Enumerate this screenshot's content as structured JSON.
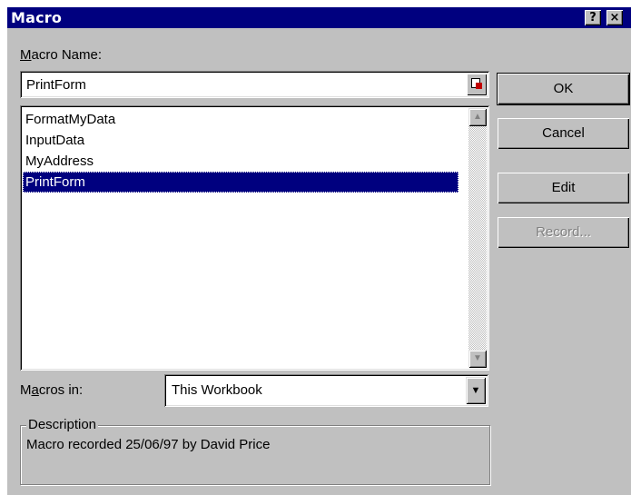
{
  "window": {
    "title": "Macro",
    "help_btn": "?",
    "close_btn": "×"
  },
  "macro_name": {
    "label_prefix": "",
    "label_accel": "M",
    "label_rest": "acro Name:",
    "value": "PrintForm"
  },
  "macro_list": {
    "items": [
      "FormatMyData",
      "InputData",
      "MyAddress",
      "PrintForm"
    ],
    "selected_index": 3
  },
  "macros_in": {
    "label_prefix": "M",
    "label_accel": "a",
    "label_rest": "cros in:",
    "value": "This Workbook"
  },
  "description": {
    "legend": "Description",
    "text": "Macro recorded 25/06/97 by David Price"
  },
  "buttons": {
    "ok": "OK",
    "cancel": "Cancel",
    "edit": "Edit",
    "record": "Record..."
  },
  "colors": {
    "titlebar": "#00007f",
    "face": "#c0c0c0",
    "selection": "#00007f"
  }
}
